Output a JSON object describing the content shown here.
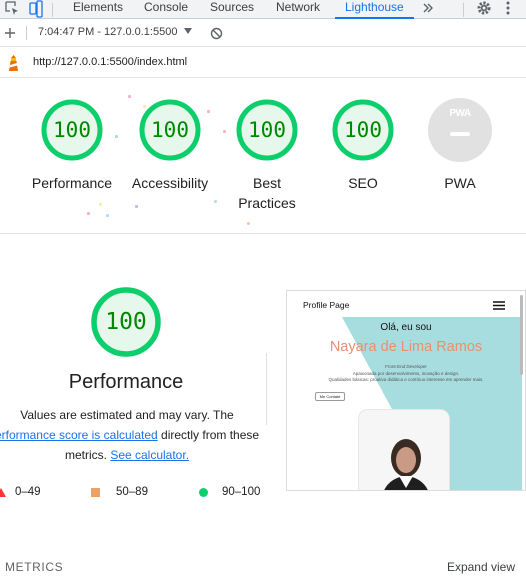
{
  "devtools": {
    "tabs": [
      "Elements",
      "Console",
      "Sources",
      "Network",
      "Lighthouse"
    ],
    "active_tab": "Lighthouse",
    "more_icon": "double-chevron-right-icon"
  },
  "toolbar": {
    "report_label": "7:04:47 PM - 127.0.0.1:5500"
  },
  "urlbar": {
    "url": "http://127.0.0.1:5500/index.html"
  },
  "gauges": [
    {
      "label": "Performance",
      "score": "100"
    },
    {
      "label": "Accessibility",
      "score": "100"
    },
    {
      "label": "Best Practices",
      "score": "100"
    },
    {
      "label": "SEO",
      "score": "100"
    },
    {
      "label": "PWA",
      "score": ""
    }
  ],
  "pwa_badge_text": "PWA",
  "performance": {
    "score": "100",
    "title": "Performance",
    "disclaimer_prefix": "Values are estimated and may vary. The ",
    "link_score": "erformance score is calculated",
    "disclaimer_middle": " directly from these metrics. ",
    "link_calculator": "See calculator."
  },
  "legend": [
    {
      "range": "0–49",
      "color": "#ff3333",
      "shape": "triangle"
    },
    {
      "range": "50–89",
      "color": "#ffaa33",
      "shape": "square"
    },
    {
      "range": "90–100",
      "color": "#0cce6b",
      "shape": "circle"
    }
  ],
  "colors": {
    "pass": "#0cce6b",
    "pass_bg": "#e6f7ec",
    "pass_text": "#008800",
    "accent": "#1a73e8"
  },
  "preview": {
    "page_title": "Profile Page",
    "hello": "Olá, eu sou",
    "name": "Nayara de Lima Ramos",
    "role": "Front-End Developer",
    "line1": "Apaixonada por desenvolvimento, inovação e design.",
    "line2": "Qualidades básicas: proativa didática e contínuo interesse em aprender mais.",
    "button": "Me Contate"
  },
  "sections": {
    "metrics": "METRICS",
    "expand": "Expand view"
  }
}
